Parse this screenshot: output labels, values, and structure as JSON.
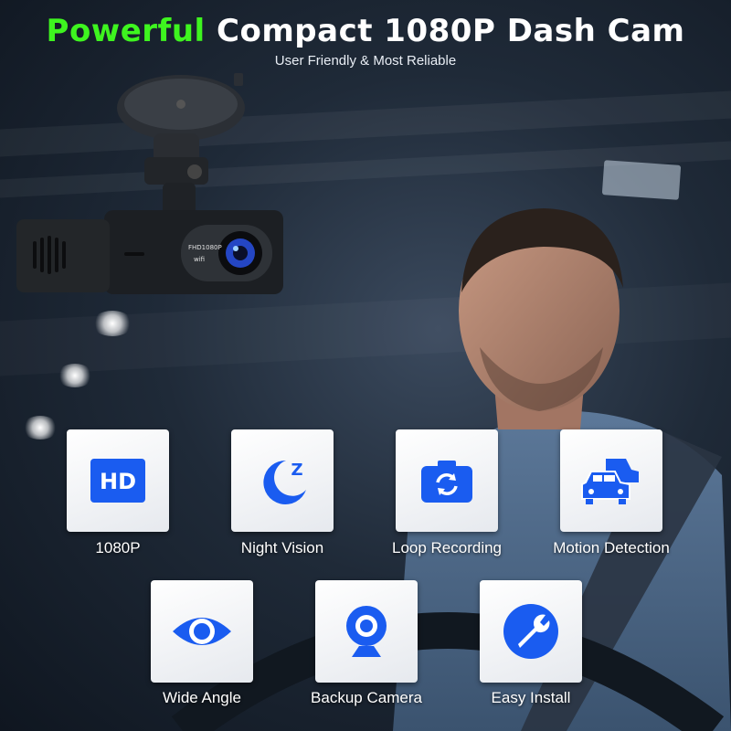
{
  "header": {
    "title_highlight": "Powerful",
    "title_rest": "Compact 1080P Dash Cam",
    "subtitle": "User Friendly & Most Reliable"
  },
  "camera": {
    "lens_label": "FHD1080P",
    "wifi_label": "wifi"
  },
  "features": [
    {
      "label": "1080P",
      "icon": "hd-icon",
      "badge": "HD"
    },
    {
      "label": "Night Vision",
      "icon": "moon-z-icon",
      "badge": "Z"
    },
    {
      "label": "Loop Recording",
      "icon": "camera-rotate-icon"
    },
    {
      "label": "Motion Detection",
      "icon": "cars-icon"
    },
    {
      "label": "Wide Angle",
      "icon": "eye-icon"
    },
    {
      "label": "Backup Camera",
      "icon": "webcam-icon"
    },
    {
      "label": "Easy Install",
      "icon": "wrench-icon"
    }
  ],
  "colors": {
    "accent_green": "#3ef51f",
    "icon_blue": "#1a5cf0",
    "text_white": "#ffffff"
  }
}
